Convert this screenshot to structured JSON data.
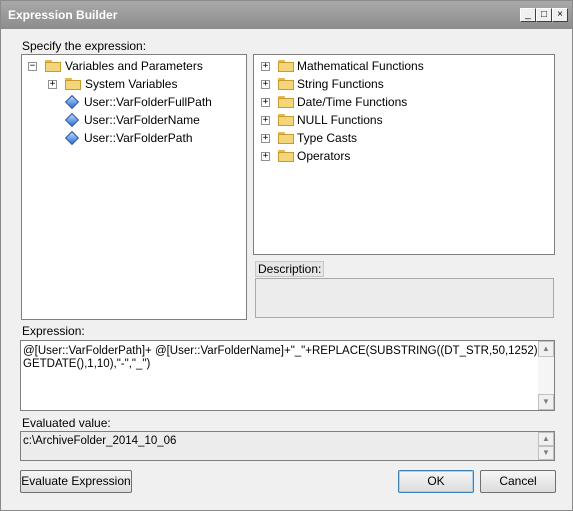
{
  "window": {
    "title": "Expression Builder",
    "controls": [
      "_",
      "□",
      "×"
    ]
  },
  "left_panel": {
    "label": "Specify the expression:",
    "tree": [
      {
        "label": "Variables and Parameters",
        "expander": "−",
        "icon": "open-folder-icon"
      },
      {
        "label": "System Variables",
        "expander": "+",
        "icon": "folder-icon"
      },
      {
        "label": "User::VarFolderFullPath",
        "icon": "variable-icon"
      },
      {
        "label": "User::VarFolderName",
        "icon": "variable-icon"
      },
      {
        "label": "User::VarFolderPath",
        "icon": "variable-icon"
      }
    ]
  },
  "functions_panel": {
    "items": [
      {
        "label": "Mathematical Functions",
        "expander": "+",
        "icon": "folder-icon"
      },
      {
        "label": "String Functions",
        "expander": "+",
        "icon": "folder-icon"
      },
      {
        "label": "Date/Time Functions",
        "expander": "+",
        "icon": "folder-icon"
      },
      {
        "label": "NULL Functions",
        "expander": "+",
        "icon": "folder-icon"
      },
      {
        "label": "Type Casts",
        "expander": "+",
        "icon": "folder-icon"
      },
      {
        "label": "Operators",
        "expander": "+",
        "icon": "folder-icon"
      }
    ]
  },
  "description": {
    "label": "Description:"
  },
  "expression": {
    "label": "Expression:",
    "line1": "@[User::VarFolderPath]+ @[User::VarFolderName]+\"_\"+REPLACE(SUBSTRING((DT_STR,50,1252)",
    "line2": "GETDATE(),1,10),\"-\",\"_\")"
  },
  "evaluated": {
    "label": "Evaluated value:",
    "value": "c:\\ArchiveFolder_2014_10_06"
  },
  "buttons": {
    "evaluate": "Evaluate Expression",
    "ok": "OK",
    "cancel": "Cancel"
  },
  "colors": {
    "titlebar": "#8c8c8c",
    "panel_bg": "#ffffff",
    "dialog_bg": "#f0f0f0"
  }
}
